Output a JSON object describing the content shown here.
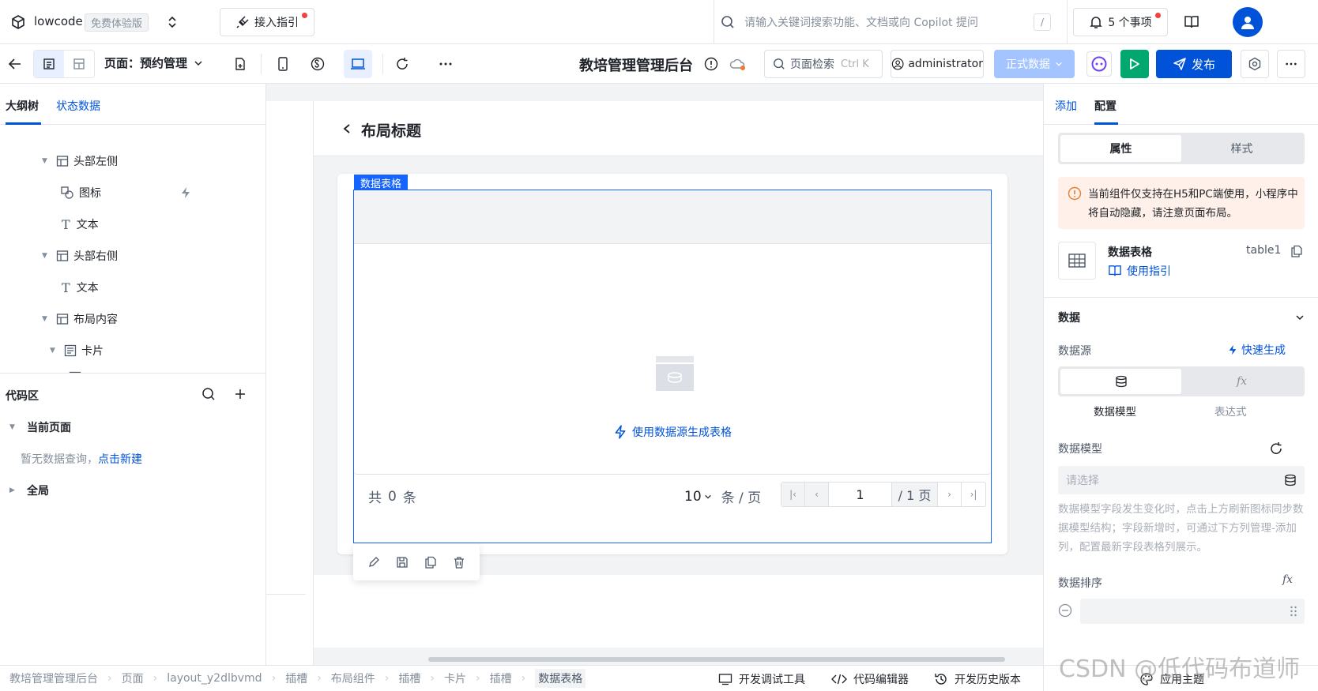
{
  "topbar": {
    "app_name": "lowcode",
    "trial_badge": "免费体验版",
    "guide_button": "接入指引",
    "search_placeholder": "请输入关键词搜索功能、文档或向 Copilot 提问",
    "search_shortcut": "/",
    "todo_label": "5 个事项"
  },
  "toolbar": {
    "page_label": "页面：预约管理",
    "app_title": "教培管理管理后台",
    "page_search_label": "页面检索",
    "page_search_shortcut": "Ctrl K",
    "user_name": "administrator",
    "env_label": "正式数据",
    "publish_label": "发布"
  },
  "left": {
    "tabs": [
      {
        "label": "大纲树"
      },
      {
        "label": "状态数据"
      }
    ],
    "tree": [
      {
        "label": "头部左侧"
      },
      {
        "label": "图标"
      },
      {
        "label": "文本"
      },
      {
        "label": "头部右侧"
      },
      {
        "label": "文本"
      },
      {
        "label": "布局内容"
      },
      {
        "label": "卡片"
      }
    ],
    "code_title": "代码区",
    "current_page": "当前页面",
    "no_query_text": "暂无数据查询，",
    "create_link": "点击新建",
    "global_label": "全局"
  },
  "canvas": {
    "layout_title": "布局标题",
    "component_tag": "数据表格",
    "generate_link": "使用数据源生成表格",
    "total_prefix": "共",
    "total_count": "0",
    "total_suffix": "条",
    "page_size": "10",
    "page_size_unit": "条 / 页",
    "current_page": "1",
    "total_pages": "/ 1 页"
  },
  "right": {
    "tabs": [
      {
        "label": "添加"
      },
      {
        "label": "配置"
      }
    ],
    "seg_props": "属性",
    "seg_style": "样式",
    "warning": "当前组件仅支持在H5和PC端使用，小程序中将自动隐藏，请注意页面布局。",
    "component_name": "数据表格",
    "component_id": "table1",
    "guide_link": "使用指引",
    "section_data": "数据",
    "datasource_label": "数据源",
    "quick_generate": "快速生成",
    "ds_model": "数据模型",
    "ds_expr": "表达式",
    "model_label": "数据模型",
    "model_placeholder": "请选择",
    "model_hint": "数据模型字段发生变化时，点击上方刷新图标同步数据模型结构；字段新增时，可通过下方列管理-添加列，配置最新字段表格列展示。",
    "sort_label": "数据排序"
  },
  "statusbar": {
    "breadcrumb": [
      "教培管理管理后台",
      "页面",
      "layout_y2dlbvmd",
      "插槽",
      "布局组件",
      "插槽",
      "卡片",
      "插槽",
      "数据表格"
    ],
    "debug_tools": "开发调试工具",
    "code_editor": "代码编辑器",
    "history": "开发历史版本",
    "theme": "应用主题"
  },
  "watermark": "CSDN @低代码布道师",
  "colors": {
    "primary": "#0052d9",
    "selection": "#1664ff",
    "green": "#00a870",
    "warn_bg": "#fff1e9",
    "warn_icon": "#ed7b2f"
  }
}
